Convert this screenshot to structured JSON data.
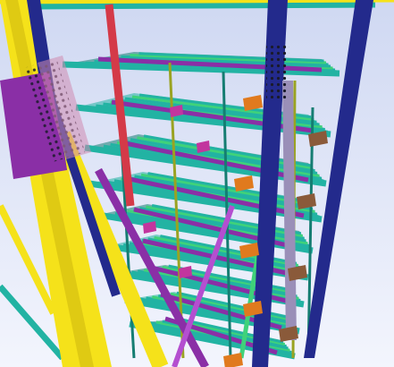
{
  "scene": {
    "subject": "steel-structure-3d-model-view",
    "colors": {
      "sky_top": "#cfd8f2",
      "sky_bottom": "#f3f5fd",
      "column_yellow": "#f5e21a",
      "column_yellow_dark": "#c9b20c",
      "column_navy": "#232a8c",
      "brace_purple": "#8a2fa6",
      "brace_purple_light": "#b44fd0",
      "beam_teal": "#22b3a3",
      "beam_teal_dark": "#157d72",
      "beam_green": "#3fd27a",
      "column_red": "#d43a48",
      "plate_magenta": "#c2359e",
      "plate_brown": "#8a5a3a",
      "plate_orange": "#e07a1e",
      "beam_olive": "#9aa322",
      "gusset_pink": "#d08ab0",
      "column_grey": "#9a8fb8",
      "bolt_hole": "#1a1a2a"
    }
  }
}
